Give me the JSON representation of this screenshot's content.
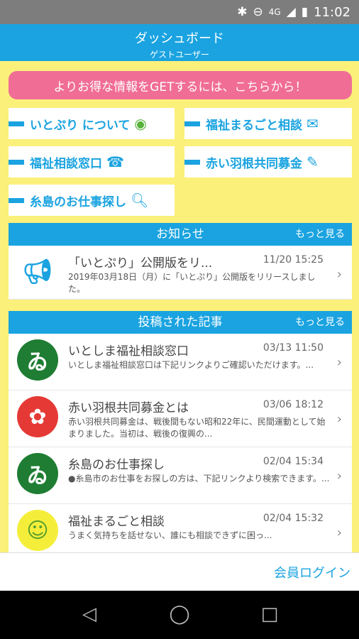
{
  "status_bar": {
    "time": "11:02",
    "network": "4G",
    "icons": [
      "bluetooth-icon",
      "do-not-disturb-icon",
      "signal-icon",
      "battery-icon"
    ]
  },
  "header": {
    "title": "ダッシュボード",
    "subtitle": "ゲストユーザー"
  },
  "promo": {
    "label": "よりお得な情報をGETするには、こちらから！"
  },
  "tiles": [
    {
      "label": "いとぷり について",
      "icon": "globe-icon"
    },
    {
      "label": "福祉まるごと相談",
      "icon": "mail-icon"
    },
    {
      "label": "福祉相談窓口",
      "icon": "phone-icon"
    },
    {
      "label": "赤い羽根共同募金",
      "icon": "feather-icon"
    },
    {
      "label": "糸島のお仕事探し",
      "icon": "search-icon"
    }
  ],
  "notices": {
    "title": "お知らせ",
    "more": "もっと見る",
    "items": [
      {
        "title": "「いとぷり」公開版をリ...",
        "time": "11/20 15:25",
        "body": "2019年03月18日（月）に「いとぷり」公開版をリリースしました。",
        "icon": "megaphone-icon"
      }
    ]
  },
  "articles": {
    "title": "投稿された記事",
    "more": "もっと見る",
    "items": [
      {
        "title": "いとしま福祉相談窓口",
        "time": "03/13 11:50",
        "body": "いとしま福祉相談窓口は下記リンクよりご確認いただけます。...",
        "thumb_color": "#1e7d32",
        "thumb_icon": "welfare-logo-icon"
      },
      {
        "title": "赤い羽根共同募金とは",
        "time": "03/06 18:12",
        "body": "赤い羽根共同募金は、戦後間もない昭和22年に、民間運動として始まりました。当初は、戦後の復興の...",
        "thumb_color": "#e53935",
        "thumb_icon": "red-feather-logo-icon"
      },
      {
        "title": "糸島のお仕事探し",
        "time": "02/04 15:34",
        "body": "●糸島市のお仕事をお探しの方は、下記リンクより検索できます。...",
        "thumb_color": "#1e7d32",
        "thumb_icon": "welfare-logo-icon"
      },
      {
        "title": "福祉まるごと相談",
        "time": "02/04 15:32",
        "body": "うまく気持ちを話せない、誰にも相談できずに困っ...",
        "thumb_color": "#f4ee3a",
        "thumb_icon": "mascot-icon"
      }
    ]
  },
  "bottom": {
    "login": "会員ログイン"
  },
  "nav": {
    "icons": [
      "back-icon",
      "home-icon",
      "recents-icon"
    ]
  }
}
